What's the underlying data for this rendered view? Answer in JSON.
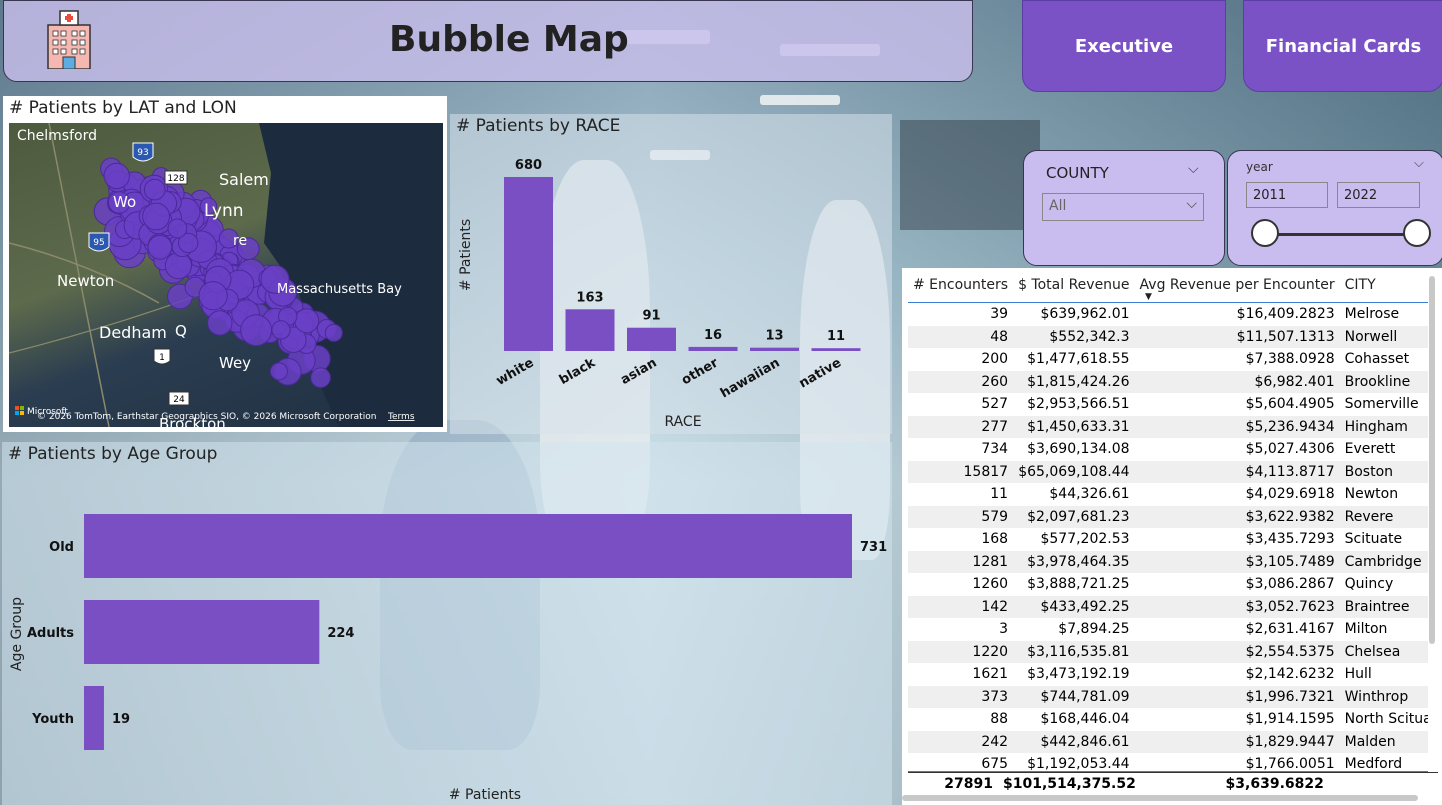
{
  "header": {
    "title": "Bubble Map"
  },
  "nav": {
    "executive": "Executive",
    "financial": "Financial Cards"
  },
  "map": {
    "title": "# Patients by LAT and LON",
    "places": [
      "Chelmsford",
      "Salem",
      "Lynn",
      "Newton",
      "Dedham",
      "Massachusetts Bay",
      "Brockton",
      "Wo",
      "Wey",
      "Q",
      "re"
    ],
    "shields": [
      "93",
      "128",
      "95",
      "1",
      "24"
    ],
    "attribution": "© 2026 TomTom, Earthstar Geographics SIO, © 2026 Microsoft Corporation",
    "terms": "Terms",
    "ms_logo": "Microsoft"
  },
  "chart_data": [
    {
      "type": "bar",
      "title": "# Patients by RACE",
      "categories": [
        "white",
        "black",
        "asian",
        "other",
        "hawaiian",
        "native"
      ],
      "values": [
        680,
        163,
        91,
        16,
        13,
        11
      ],
      "xlabel": "RACE",
      "ylabel": "# Patients",
      "color": "#7a4fc4"
    },
    {
      "type": "bar",
      "orientation": "horizontal",
      "title": "# Patients by Age Group",
      "categories": [
        "Old",
        "Adults",
        "Youth"
      ],
      "values": [
        731,
        224,
        19
      ],
      "xlabel": "# Patients",
      "ylabel": "Age Group",
      "color": "#7a4fc4"
    }
  ],
  "county": {
    "label": "COUNTY",
    "value": "All"
  },
  "year": {
    "label": "year",
    "from": "2011",
    "to": "2022",
    "range": [
      2011,
      2022
    ]
  },
  "table": {
    "headers": [
      "# Encounters",
      "$ Total Revenue",
      "Avg Revenue per Encounter",
      "CITY"
    ],
    "rows": [
      [
        "39",
        "$639,962.01",
        "$16,409.2823",
        "Melrose"
      ],
      [
        "48",
        "$552,342.3",
        "$11,507.1313",
        "Norwell"
      ],
      [
        "200",
        "$1,477,618.55",
        "$7,388.0928",
        "Cohasset"
      ],
      [
        "260",
        "$1,815,424.26",
        "$6,982.401",
        "Brookline"
      ],
      [
        "527",
        "$2,953,566.51",
        "$5,604.4905",
        "Somerville"
      ],
      [
        "277",
        "$1,450,633.31",
        "$5,236.9434",
        "Hingham"
      ],
      [
        "734",
        "$3,690,134.08",
        "$5,027.4306",
        "Everett"
      ],
      [
        "15817",
        "$65,069,108.44",
        "$4,113.8717",
        "Boston"
      ],
      [
        "11",
        "$44,326.61",
        "$4,029.6918",
        "Newton"
      ],
      [
        "579",
        "$2,097,681.23",
        "$3,622.9382",
        "Revere"
      ],
      [
        "168",
        "$577,202.53",
        "$3,435.7293",
        "Scituate"
      ],
      [
        "1281",
        "$3,978,464.35",
        "$3,105.7489",
        "Cambridge"
      ],
      [
        "1260",
        "$3,888,721.25",
        "$3,086.2867",
        "Quincy"
      ],
      [
        "142",
        "$433,492.25",
        "$3,052.7623",
        "Braintree"
      ],
      [
        "3",
        "$7,894.25",
        "$2,631.4167",
        "Milton"
      ],
      [
        "1220",
        "$3,116,535.81",
        "$2,554.5375",
        "Chelsea"
      ],
      [
        "1621",
        "$3,473,192.19",
        "$2,142.6232",
        "Hull"
      ],
      [
        "373",
        "$744,781.09",
        "$1,996.7321",
        "Winthrop"
      ],
      [
        "88",
        "$168,446.04",
        "$1,914.1595",
        "North Scituate"
      ],
      [
        "242",
        "$442,846.61",
        "$1,829.9447",
        "Malden"
      ],
      [
        "675",
        "$1,192,053.44",
        "$1,766.0051",
        "Medford"
      ]
    ],
    "totals": [
      "27891",
      "$101,514,375.52",
      "$3,639.6822",
      ""
    ]
  }
}
